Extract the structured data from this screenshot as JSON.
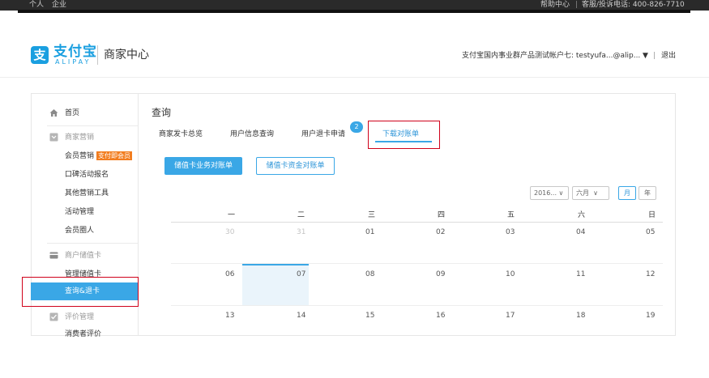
{
  "topbar": {
    "left_links": [
      "个人",
      "企业"
    ],
    "help": "帮助中心",
    "separator": "|",
    "hotline": "客服/投诉电话: 400-826-7710"
  },
  "header": {
    "logo_mark": "支",
    "logo_cn": "支付宝",
    "logo_en": "ALIPAY",
    "title": "商家中心",
    "account": "支付宝国内事业群产品测试帐户七: testyufa...@alip...",
    "dropdown_glyph": "▼",
    "separator": "|",
    "logout": "退出"
  },
  "sidebar": {
    "home": "首页",
    "marketing_head": "商家营销",
    "member_marketing": "会员营销",
    "member_tag": "支付即会员",
    "koubei_signup": "口碑活动报名",
    "other_tools": "其他营销工具",
    "activity_mgmt": "活动管理",
    "member_circle": "会员圈人",
    "stored_card_head": "商户储值卡",
    "manage_card": "管理储值卡",
    "query_refund": "查询&退卡",
    "review_head": "评价管理",
    "consumer_review": "消费者评价"
  },
  "main": {
    "title": "查询",
    "tabs": [
      "商家发卡总览",
      "用户信息查询",
      "用户退卡申请",
      "下载对账单"
    ],
    "badge_count": "2",
    "btn_business": "储值卡业务对账单",
    "btn_funds": "储值卡资金对账单",
    "year_select": "2016...",
    "month_select": "六月",
    "view_month": "月",
    "view_year": "年",
    "weekdays": [
      "一",
      "二",
      "三",
      "四",
      "五",
      "六",
      "日"
    ],
    "weeks": [
      [
        "30",
        "31",
        "01",
        "02",
        "03",
        "04",
        "05"
      ],
      [
        "06",
        "07",
        "08",
        "09",
        "10",
        "11",
        "12"
      ],
      [
        "13",
        "14",
        "15",
        "16",
        "17",
        "18",
        "19"
      ]
    ],
    "selected_day": "07"
  },
  "colors": {
    "accent": "#3aa7e6",
    "highlight_border": "#d0021b",
    "tag": "#f27d1f"
  }
}
